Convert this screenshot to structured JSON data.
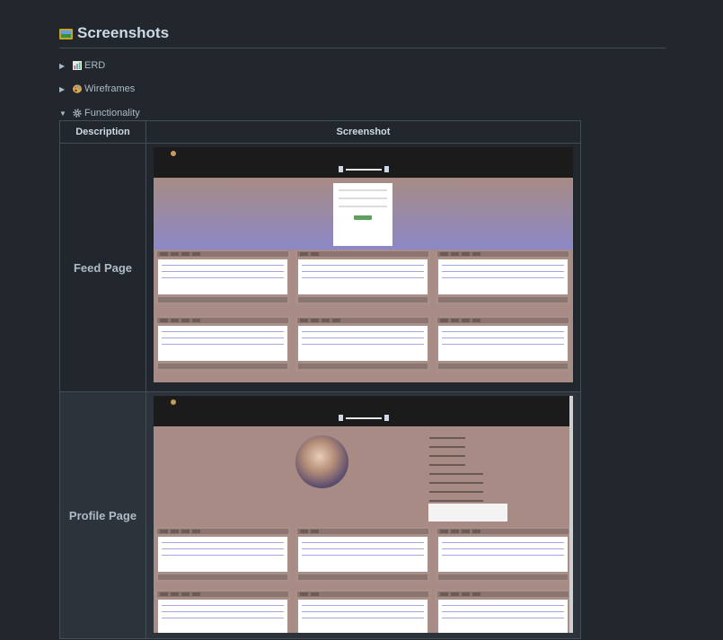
{
  "section": {
    "title": "Screenshots",
    "icon": "framed-picture-icon"
  },
  "details": [
    {
      "label": "ERD",
      "icon": "bar-chart-icon",
      "expanded": false
    },
    {
      "label": "Wireframes",
      "icon": "palette-icon",
      "expanded": false
    },
    {
      "label": "Functionality",
      "icon": "gear-icon",
      "expanded": true
    }
  ],
  "table": {
    "headers": {
      "description": "Description",
      "screenshot": "Screenshot"
    },
    "rows": [
      {
        "description": "Feed Page"
      },
      {
        "description": "Profile Page"
      }
    ]
  }
}
